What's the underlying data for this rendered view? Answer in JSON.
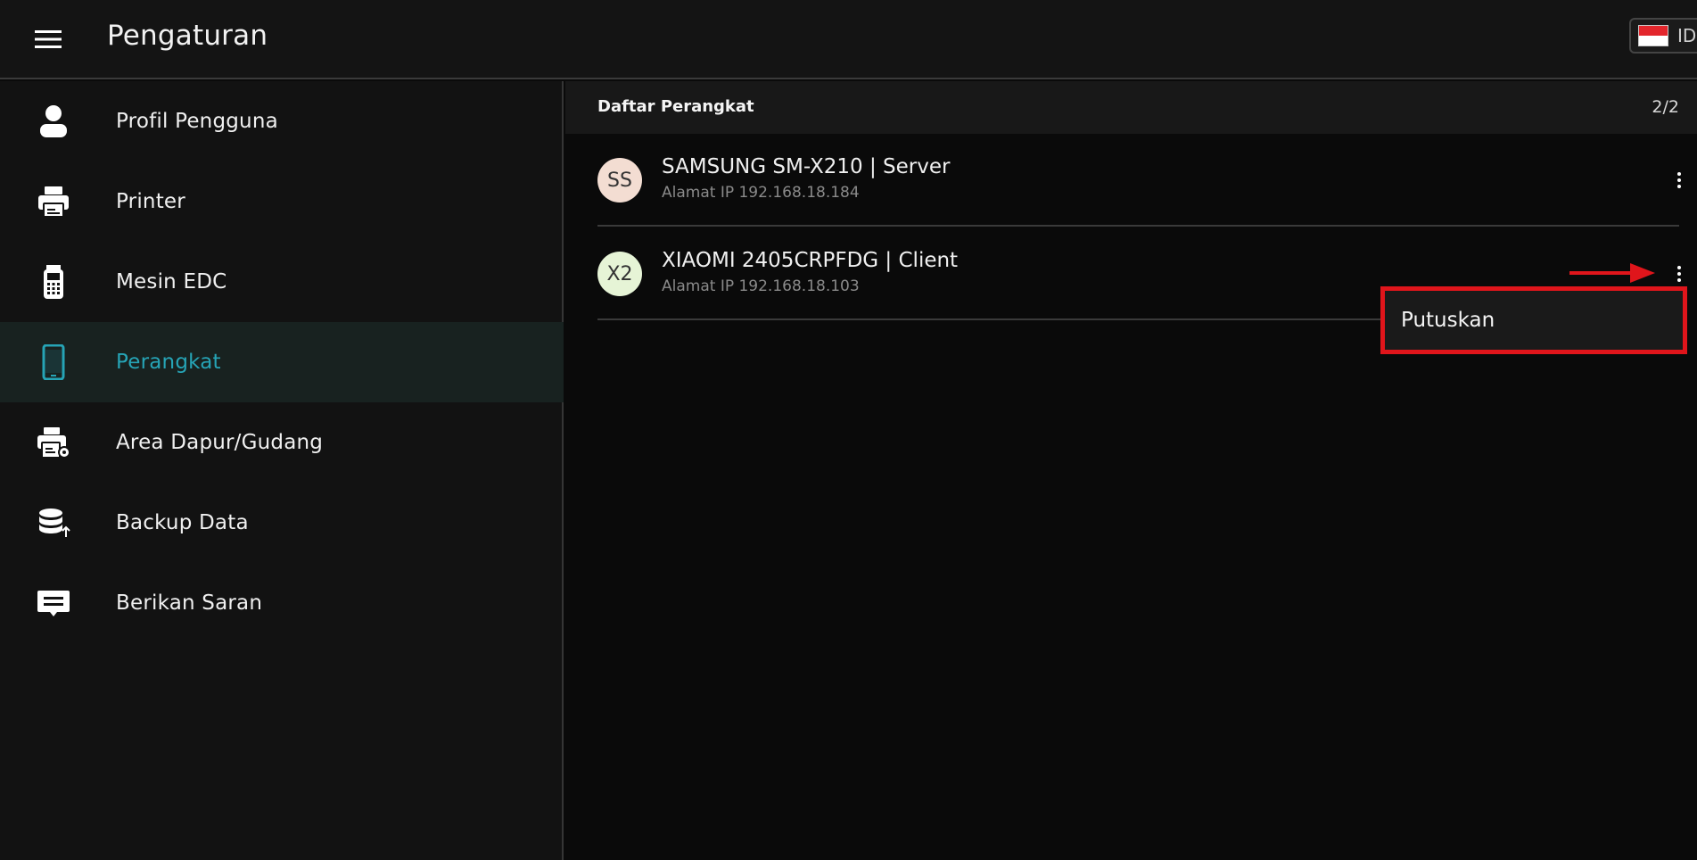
{
  "header": {
    "title": "Pengaturan",
    "language_code": "ID",
    "flag_colors": {
      "top": "#e3262c",
      "bottom": "#ffffff"
    }
  },
  "sidebar": {
    "items": [
      {
        "label": "Profil Pengguna",
        "icon": "user-icon",
        "active": false
      },
      {
        "label": "Printer",
        "icon": "printer-icon",
        "active": false
      },
      {
        "label": "Mesin EDC",
        "icon": "edc-machine-icon",
        "active": false
      },
      {
        "label": "Perangkat",
        "icon": "smartphone-icon",
        "active": true
      },
      {
        "label": "Area Dapur/Gudang",
        "icon": "printer-settings-icon",
        "active": false
      },
      {
        "label": "Backup Data",
        "icon": "database-upload-icon",
        "active": false
      },
      {
        "label": "Berikan Saran",
        "icon": "feedback-icon",
        "active": false
      }
    ]
  },
  "devices": {
    "title": "Daftar Perangkat",
    "count": "2/2",
    "items": [
      {
        "initials": "SS",
        "name": "SAMSUNG SM-X210 | Server",
        "ip": "Alamat IP 192.168.18.184",
        "avatar_color": "#f3ddd2"
      },
      {
        "initials": "X2",
        "name": "XIAOMI 2405CRPFDG | Client",
        "ip": "Alamat IP 192.168.18.103",
        "avatar_color": "#e6f4d6"
      }
    ]
  },
  "context_menu": {
    "items": [
      {
        "label": "Putuskan"
      }
    ],
    "highlight_color": "#e0151b"
  },
  "colors": {
    "accent": "#26a4b6",
    "background": "#0a0a0a",
    "sidebar_bg": "#121212",
    "active_bg": "#182220"
  }
}
